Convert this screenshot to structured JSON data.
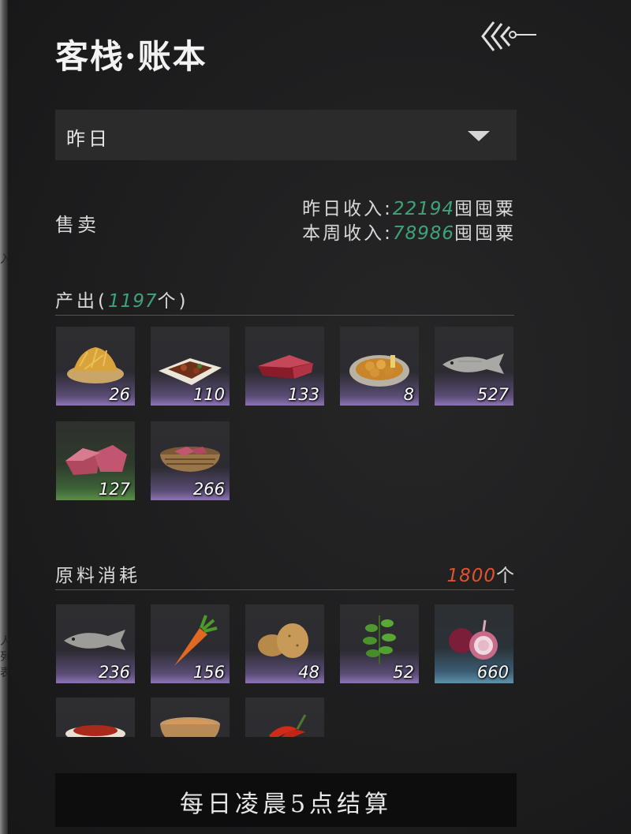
{
  "header": {
    "title": "客栈·账本"
  },
  "filter": {
    "selected": "昨日"
  },
  "sales": {
    "label": "售卖",
    "yesterday_prefix": "昨日收入:",
    "yesterday_value": "22194",
    "yesterday_unit": "囤囤粟",
    "week_prefix": "本周收入:",
    "week_value": "78986",
    "week_unit": "囤囤粟"
  },
  "output": {
    "label_prefix": "产出(",
    "count": "1197",
    "label_suffix": "个)",
    "items": [
      {
        "icon": "fried-noodle-dish-icon",
        "qty": "26"
      },
      {
        "icon": "braised-meat-dish-icon",
        "qty": "110"
      },
      {
        "icon": "raw-steak-icon",
        "qty": "133"
      },
      {
        "icon": "fried-tofu-plate-icon",
        "qty": "8"
      },
      {
        "icon": "fish-icon",
        "qty": "527"
      },
      {
        "icon": "meat-chunks-icon",
        "qty": "127"
      },
      {
        "icon": "meat-basket-icon",
        "qty": "266"
      }
    ]
  },
  "materials": {
    "label": "原料消耗",
    "count": "1800",
    "unit": "个",
    "items": [
      {
        "icon": "fish-icon",
        "qty": "236"
      },
      {
        "icon": "carrot-icon",
        "qty": "156"
      },
      {
        "icon": "potato-icon",
        "qty": "48"
      },
      {
        "icon": "herb-icon",
        "qty": "52"
      },
      {
        "icon": "onion-icon",
        "qty": "660"
      },
      {
        "icon": "chili-dish-icon",
        "qty": ""
      },
      {
        "icon": "soup-bowl-icon",
        "qty": ""
      },
      {
        "icon": "chili-pepper-icon",
        "qty": ""
      }
    ]
  },
  "footer": {
    "settle_label": "每日凌晨5点结算"
  },
  "left_edge_fragments": [
    "入",
    "人列表"
  ]
}
